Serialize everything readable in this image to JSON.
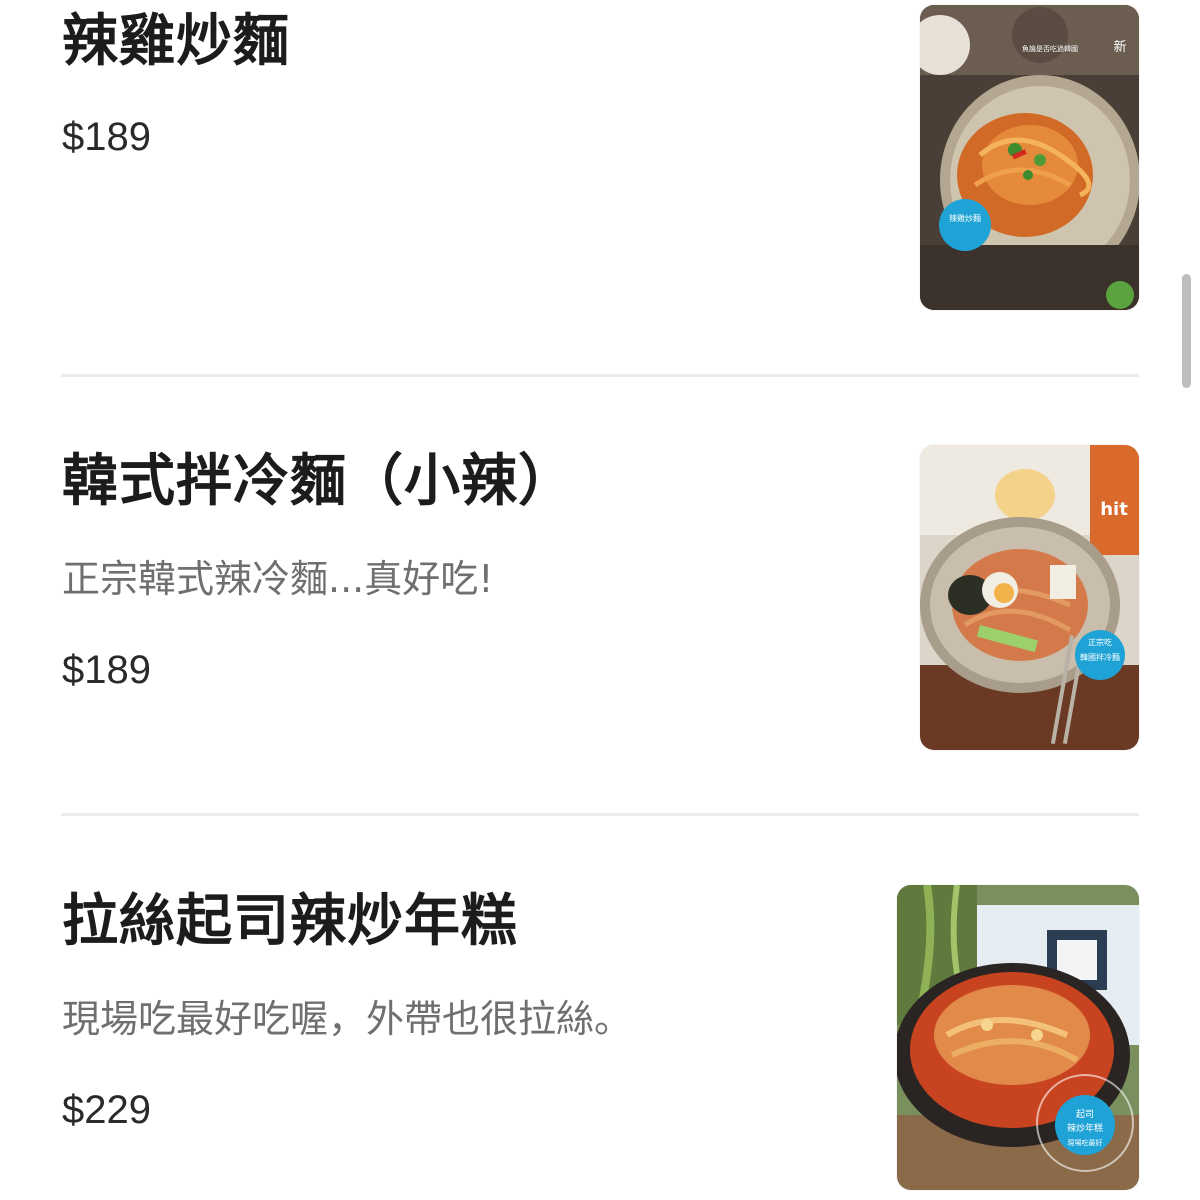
{
  "menu": {
    "items": [
      {
        "name": "辣雞炒麵",
        "description": "",
        "price": "$189",
        "image_text": [
          "新",
          "魚論是否吃過韓國",
          "辣雞炒麵"
        ]
      },
      {
        "name": "韓式拌冷麵（小辣）",
        "description": "正宗韓式辣冷麵...真好吃!",
        "price": "$189",
        "image_text": [
          "正宗吃",
          "韓國拌冷麵",
          "hit"
        ]
      },
      {
        "name": "拉絲起司辣炒年糕",
        "description": "現場吃最好吃喔，外帶也很拉絲。",
        "price": "$229",
        "image_text": [
          "起司",
          "辣炒年糕",
          "現場吃最好"
        ]
      }
    ]
  },
  "colors": {
    "title": "#1c1c1c",
    "description": "#6f6f6f",
    "price": "#2a2a2a",
    "divider": "#ececec",
    "badge": "#1fa3d6",
    "scrollbar": "#bdbdbd"
  }
}
